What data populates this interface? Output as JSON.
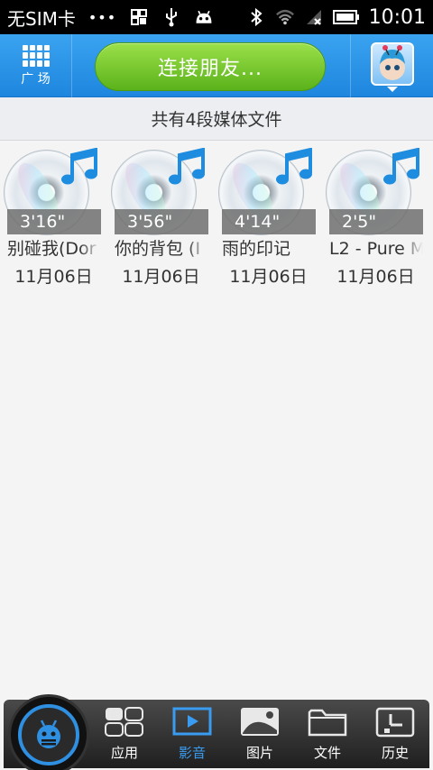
{
  "status_bar": {
    "carrier": "无SIM卡",
    "dots": "•••",
    "time": "10:01"
  },
  "top_bar": {
    "plaza_label": "广 场",
    "connect_label": "连接朋友..."
  },
  "summary": {
    "text": "共有4段媒体文件"
  },
  "media_items": [
    {
      "duration": "3'16\"",
      "title": "别碰我(Dor",
      "date": "11月06日"
    },
    {
      "duration": "3'56\"",
      "title": "你的背包 (I",
      "date": "11月06日"
    },
    {
      "duration": "4'14\"",
      "title": "雨的印记",
      "date": "11月06日"
    },
    {
      "duration": "2'5\"",
      "title": "L2 - Pure M",
      "date": "11月06日"
    }
  ],
  "bottom_nav": {
    "items": [
      {
        "label": "应用",
        "icon": "apps-icon"
      },
      {
        "label": "影音",
        "icon": "play-icon"
      },
      {
        "label": "图片",
        "icon": "image-icon"
      },
      {
        "label": "文件",
        "icon": "folder-icon"
      },
      {
        "label": "历史",
        "icon": "history-icon"
      }
    ],
    "active_index": 1
  },
  "colors": {
    "accent_blue": "#2f8fe0",
    "connect_green": "#6cc026",
    "nav_active": "#3a9cf0"
  }
}
